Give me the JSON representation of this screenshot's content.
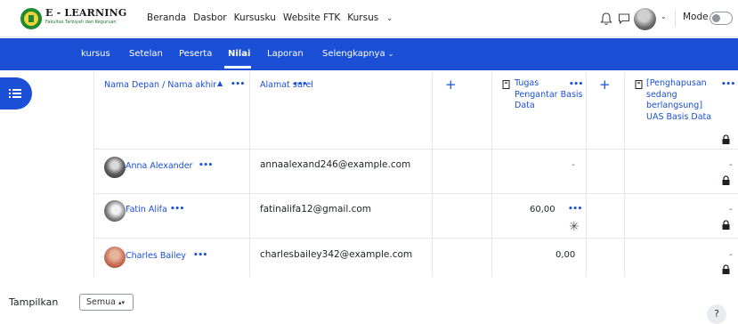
{
  "brand": {
    "title": "E - LEARNING",
    "subtitle": "Fakultas Tarbiyah dan Keguruan"
  },
  "topnav": {
    "items": [
      "Beranda",
      "Dasbor",
      "Kursusku",
      "Website FTK",
      "Kursus"
    ]
  },
  "user_menu": {
    "mode_edit_label": "Mode Edit",
    "mode_edit_on": false
  },
  "course_nav": {
    "tabs": [
      "kursus",
      "Setelan",
      "Peserta",
      "Nilai",
      "Laporan",
      "Selengkapnya"
    ],
    "active": "Nilai"
  },
  "grader": {
    "columns": {
      "name": "Nama Depan / Nama akhir",
      "email": "Alamat surel",
      "item1_lines": [
        "Tugas",
        "Pengantar Basis",
        "Data"
      ],
      "item2_lines": [
        "[Penghapusan",
        "sedang",
        "berlangsung]",
        "UAS Basis Data"
      ]
    },
    "rows": [
      {
        "name": "Anna Alexander",
        "email": "annaalexand246@example.com",
        "grade1": "-",
        "grade2": "-"
      },
      {
        "name": "Fatin Alifa",
        "email": "fatinalifa12@gmail.com",
        "grade1": "60,00",
        "grade2": "-"
      },
      {
        "name": "Charles Bailey",
        "email": "charlesbailey342@example.com",
        "grade1": "0,00",
        "grade2": "-"
      }
    ]
  },
  "footer": {
    "show_label": "Tampilkan",
    "show_value": "Semua",
    "help_label": "?"
  },
  "colors": {
    "accent": "#1a4fd6",
    "text": "#1d2125"
  }
}
